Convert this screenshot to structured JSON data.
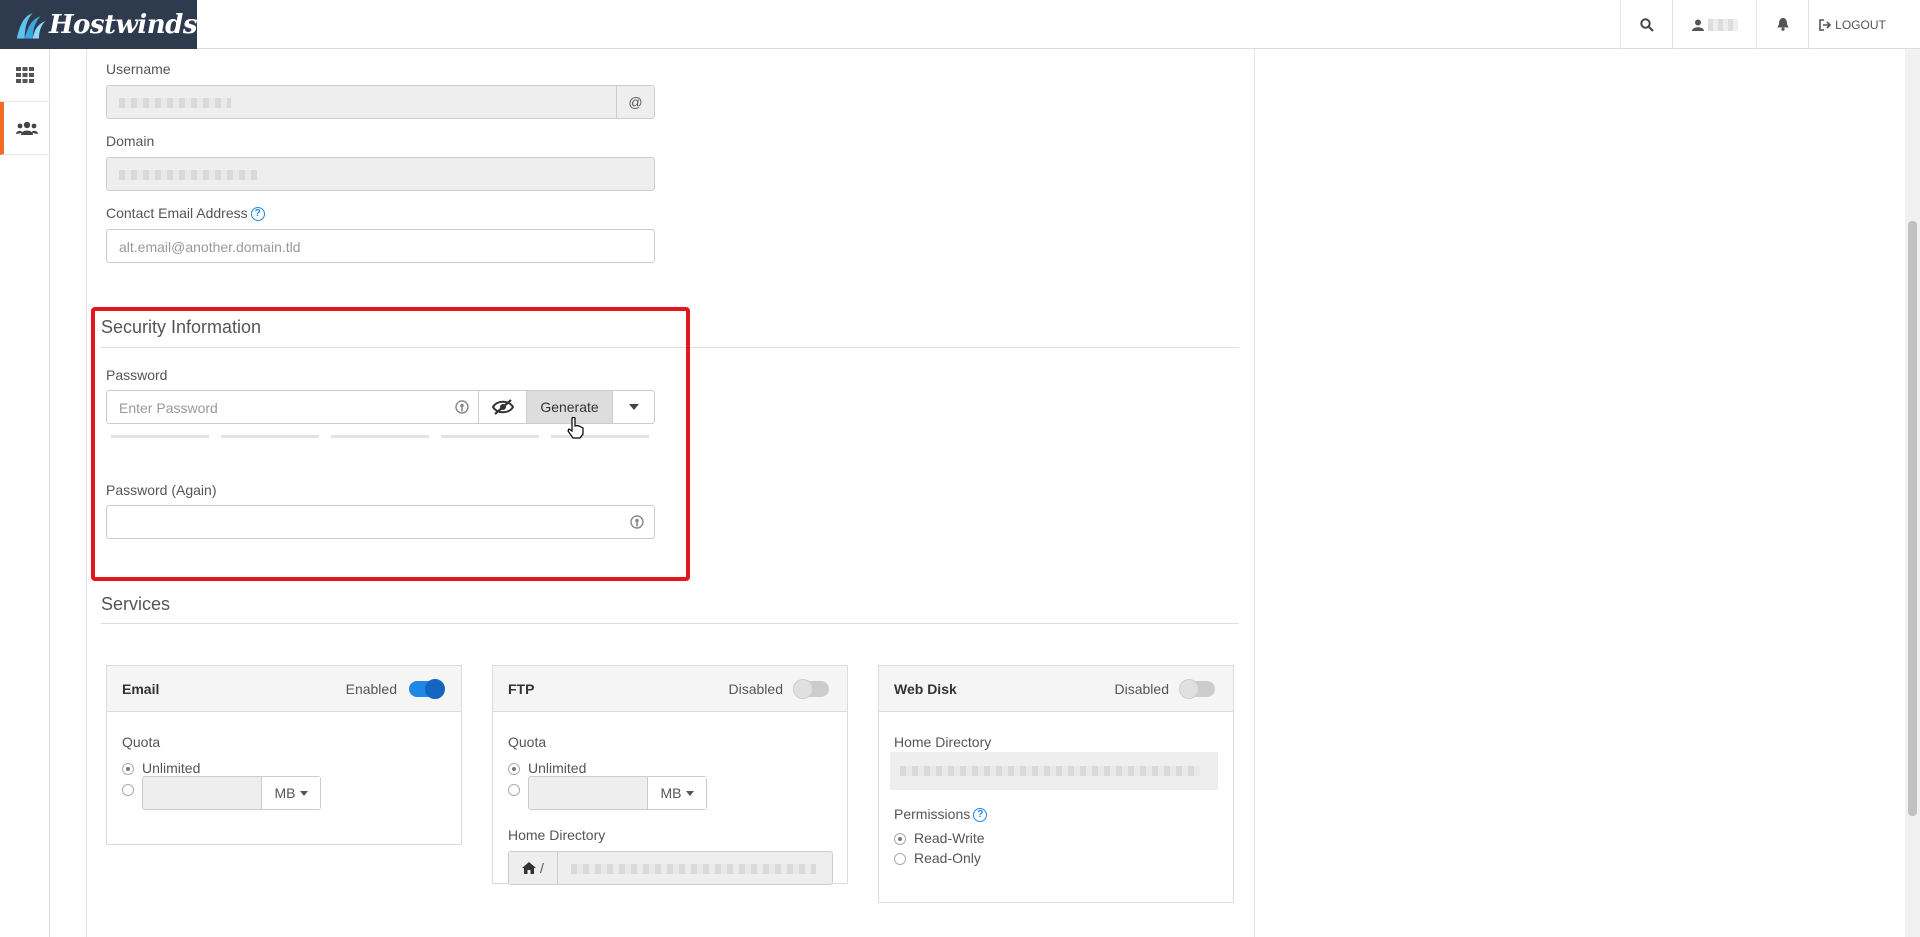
{
  "header": {
    "brand": "Hostwinds",
    "logout_label": "LOGOUT"
  },
  "account": {
    "username_label": "Username",
    "username_addon": "@",
    "domain_label": "Domain",
    "contact_label": "Contact Email Address",
    "contact_placeholder": "alt.email@another.domain.tld"
  },
  "security": {
    "title": "Security Information",
    "password_label": "Password",
    "password_placeholder": "Enter Password",
    "generate_label": "Generate",
    "password_again_label": "Password (Again)"
  },
  "services": {
    "title": "Services",
    "email": {
      "title": "Email",
      "status": "Enabled",
      "quota_label": "Quota",
      "unlimited_label": "Unlimited",
      "unit": "MB"
    },
    "ftp": {
      "title": "FTP",
      "status": "Disabled",
      "quota_label": "Quota",
      "unlimited_label": "Unlimited",
      "unit": "MB",
      "home_label": "Home Directory",
      "home_prefix": "/"
    },
    "webdisk": {
      "title": "Web Disk",
      "status": "Disabled",
      "home_label": "Home Directory",
      "permissions_label": "Permissions",
      "read_write": "Read-Write",
      "read_only": "Read-Only"
    }
  },
  "colors": {
    "brand_bg": "#2e3b4e",
    "accent_orange": "#f36c21",
    "highlight_red": "#e3161b",
    "toggle_blue": "#1e88e5"
  }
}
